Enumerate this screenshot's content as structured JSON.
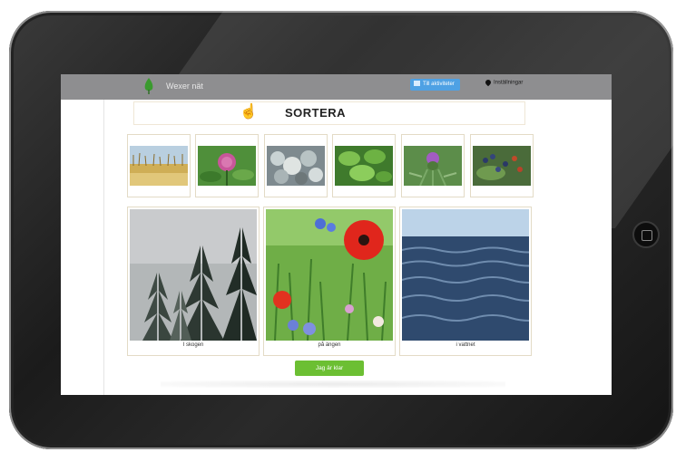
{
  "header": {
    "site_name": "Wexer nät",
    "primary_button": "Till aktiviteter",
    "secondary_link": "Inställningar"
  },
  "page": {
    "title": "SORTERA",
    "hand_icon": "pointing-hand-icon"
  },
  "thumbnails": [
    {
      "name": "thumb-reeds",
      "description_icon": "reeds-image"
    },
    {
      "name": "thumb-clover",
      "description_icon": "clover-image"
    },
    {
      "name": "thumb-lichen",
      "description_icon": "lichen-image"
    },
    {
      "name": "thumb-leaves",
      "description_icon": "leaves-image"
    },
    {
      "name": "thumb-thistle",
      "description_icon": "thistle-image"
    },
    {
      "name": "thumb-berries",
      "description_icon": "berries-image"
    }
  ],
  "categories": [
    {
      "label": "I skogen"
    },
    {
      "label": "på ängen"
    },
    {
      "label": "i vattnet"
    }
  ],
  "actions": {
    "done_button": "Jag är klar"
  },
  "colors": {
    "topbar": "#8e8e90",
    "primary": "#4ea1e4",
    "done": "#6cbf33"
  }
}
